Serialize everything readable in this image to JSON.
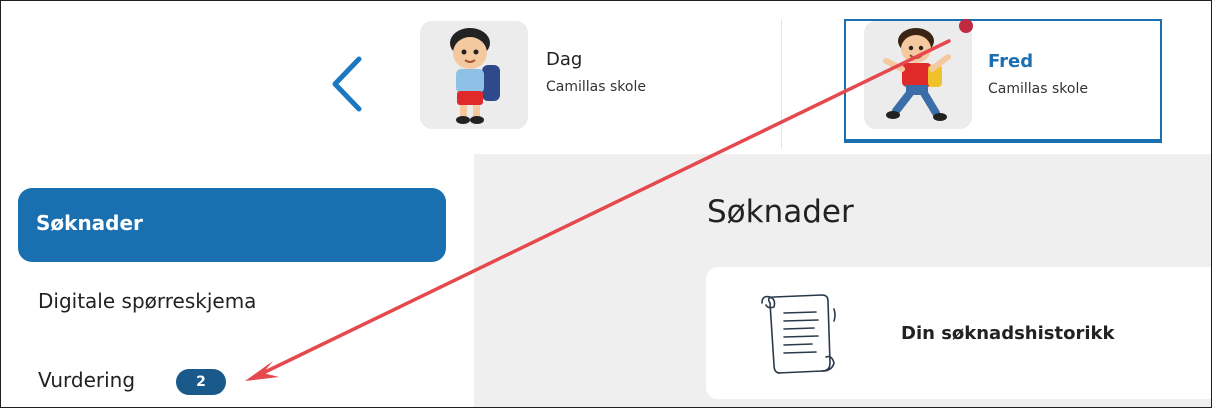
{
  "header": {
    "back_icon": "chevron-left-icon",
    "children": [
      {
        "name": "Dag",
        "school": "Camillas skole",
        "selected": false
      },
      {
        "name": "Fred",
        "school": "Camillas skole",
        "selected": true
      }
    ]
  },
  "sidebar": {
    "items": [
      {
        "label": "Søknader",
        "active": true
      },
      {
        "label": "Digitale spørreskjema",
        "active": false
      },
      {
        "label": "Vurdering",
        "badge": "2",
        "active": false
      }
    ]
  },
  "main": {
    "title": "Søknader",
    "card": {
      "label": "Din søknadshistorikk",
      "icon": "scroll-icon"
    }
  },
  "colors": {
    "accent": "#1a6fb0",
    "badge": "#1a5a8a",
    "notification": "#c0293f",
    "annotation_arrow": "#e5484d",
    "panel_bg": "#efefef"
  }
}
